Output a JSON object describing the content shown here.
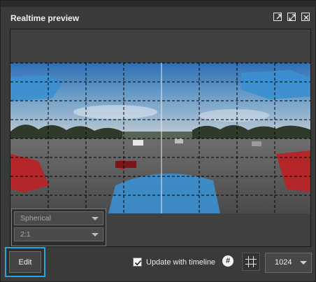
{
  "window": {
    "title": "Realtime preview",
    "header_icons": [
      "popout-icon",
      "maximize-icon",
      "close-icon"
    ]
  },
  "viewport": {
    "content": "spherical panorama preview with grid overlay"
  },
  "projection": {
    "type_value": "Spherical",
    "ratio_value": "2:1"
  },
  "toolbar": {
    "edit_label": "Edit",
    "update_label": "Update with timeline",
    "update_checked": true,
    "hash_label": "#",
    "resolution_value": "1024"
  },
  "colors": {
    "accent": "#2aa5e0",
    "panel": "#3a3a3a",
    "viewport_bg": "#404040"
  }
}
